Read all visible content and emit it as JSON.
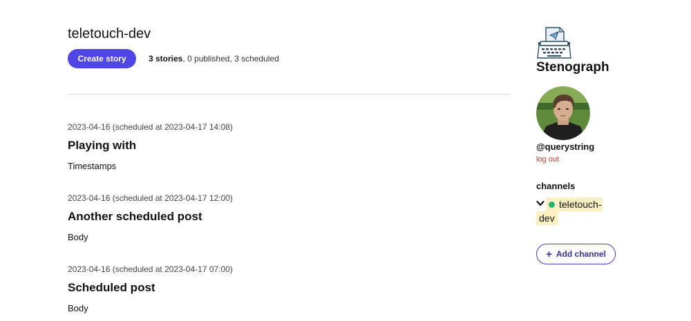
{
  "channel": {
    "title": "teletouch-dev"
  },
  "toolbar": {
    "create_label": "Create story",
    "summary_count": "3 stories",
    "summary_rest": ", 0 published, 3 scheduled"
  },
  "stories": [
    {
      "meta": "2023-04-16 (scheduled at 2023-04-17 14:08)",
      "title": "Playing with",
      "body": "Timestamps"
    },
    {
      "meta": "2023-04-16 (scheduled at 2023-04-17 12:00)",
      "title": "Another scheduled post",
      "body": "Body"
    },
    {
      "meta": "2023-04-16 (scheduled at 2023-04-17 07:00)",
      "title": "Scheduled post",
      "body": "Body"
    }
  ],
  "sidebar": {
    "brand": "Stenograph",
    "logo_icon": "typewriter-icon",
    "username": "@querystring",
    "logout_label": "log out",
    "channels_heading": "channels",
    "channel_item": {
      "name_part1": "teletouch-",
      "name_part2": "dev",
      "status_color": "#22b573",
      "highlight_color": "#fdf1c4"
    },
    "add_channel_label": "Add channel"
  },
  "colors": {
    "accent": "#4f46e5",
    "logout": "#c0392b"
  }
}
